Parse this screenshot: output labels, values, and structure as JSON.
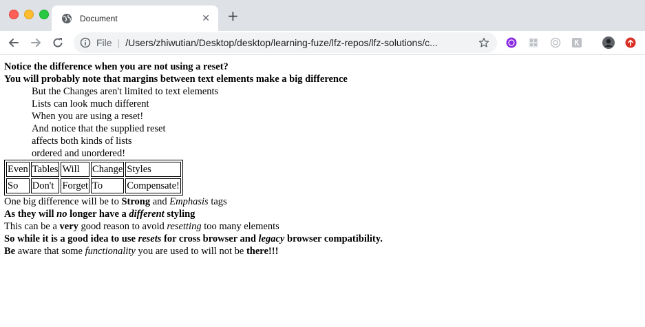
{
  "browser": {
    "tab_title": "Document",
    "new_tab": "+",
    "tab_close": "✕",
    "scheme_label": "File",
    "separator": "|",
    "url": "/Users/zhiwutian/Desktop/desktop/learning-fuze/lfz-repos/lfz-solutions/c..."
  },
  "page": {
    "heading1": "Notice the difference when you are not using a reset?",
    "heading2": "You will probably note that margins between text elements make a big difference",
    "list_items": [
      "But the Changes aren't limited to text elements",
      "Lists can look much different",
      "When you are using a reset!",
      "And notice that the supplied reset",
      "affects both kinds of lists",
      "ordered and unordered!"
    ],
    "table": [
      [
        "Even",
        "Tables",
        "Will",
        "Change",
        "Styles"
      ],
      [
        "So",
        "Don't",
        "Forget",
        "To",
        "Compensate!"
      ]
    ],
    "p1": {
      "a": "One big difference will be to ",
      "strong": "Strong",
      "b": " and ",
      "em": "Emphasis",
      "c": " tags"
    },
    "p2": {
      "a": "As they will ",
      "em1": "no",
      "b": " longer have a ",
      "em2": "different",
      "c": " styling"
    },
    "p3": {
      "a": "This can be a ",
      "strong": "very",
      "b": " good reason to avoid ",
      "em": "resetting",
      "c": " too many elements"
    },
    "p4": {
      "a": "So while it is a good idea to use ",
      "em1": "resets",
      "b": " for cross browser and ",
      "em2": "legacy",
      "c": " browser compatibility."
    },
    "p5": {
      "strong1": "Be",
      "a": " aware that some ",
      "em": "functionality",
      "b": " you are used to will not be ",
      "strong2": "there!!!"
    }
  }
}
